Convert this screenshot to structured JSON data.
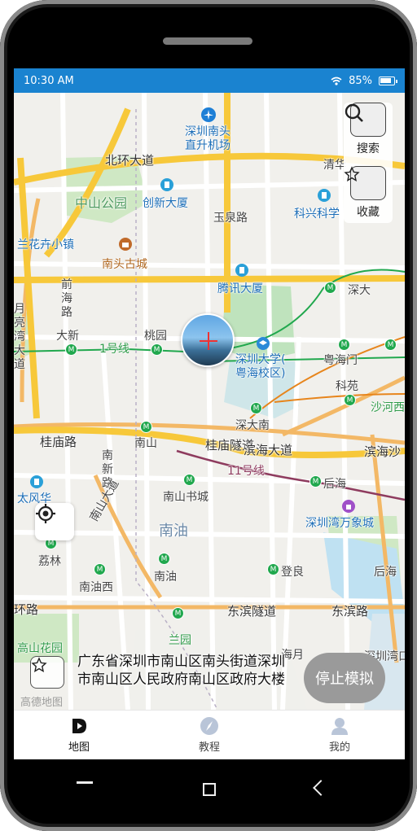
{
  "status_bar": {
    "time": "10:30 AM",
    "battery_percent": "85%",
    "battery_level": 0.85,
    "icons": [
      "wifi-icon",
      "battery-icon"
    ]
  },
  "map": {
    "labels": {
      "airport": "深圳南头\n直升机场",
      "beihuan": "北环大道",
      "qinghu": "清华",
      "zhongshan_park": "中山公园",
      "chuangxin": "创新大厦",
      "yuquan": "玉泉路",
      "kexing": "科兴科学",
      "nantou_old": "南头古城",
      "tencent": "腾讯大厦",
      "flower_town": "兰花卉小镇",
      "qianhai_rd": "前\n海\n路",
      "yueliangwan": "月\n亮\n湾\n大\n道",
      "daxin": "大新",
      "taoyuan": "桃园",
      "line1": "1号线",
      "shenzhen_univ": "深圳大学(\n粤海校区)",
      "shenda": "深大",
      "yuehaimen": "粤海门",
      "kexue": "科苑",
      "shahe": "沙河西",
      "shendanan": "深大南",
      "guimiao": "桂庙路",
      "nanshan_stn": "南山",
      "guimiao_tunnel": "桂庙隧道",
      "binhai": "滨海大道",
      "binhai2": "滨海沙",
      "line11": "11号线",
      "houhai": "后海",
      "nanxin": "南\n新\n路",
      "nanshan_ave": "南山大道",
      "nanshan_books": "南山书城",
      "nanyou": "南油",
      "mixc": "深圳湾万象城",
      "taifeng": "太风华",
      "lilin": "荔林",
      "nanyouxi": "南油西",
      "nanyou_stn": "南油",
      "dengliang": "登良",
      "houhai2": "后海",
      "dongbin_rd": "东滨路",
      "dongbin_tunnel": "东滨隧道",
      "dongbin2": "东滨路",
      "huan_rd": "环路",
      "lanyuan": "兰园",
      "gaoxin_park": "高山花园",
      "haiyue": "海月",
      "wanke": "深圳湾口岸",
      "gaode": "高德地图"
    }
  },
  "side_panel": {
    "search_label": "搜索",
    "favorite_label": "收藏"
  },
  "address": {
    "text": "广东省深圳市南山区南头街道深圳市南山区人民政府南山区政府大楼"
  },
  "stop_button": "停止模拟",
  "tabs": [
    {
      "label": "地图",
      "icon": "map-play-icon"
    },
    {
      "label": "教程",
      "icon": "compass-icon"
    },
    {
      "label": "我的",
      "icon": "user-icon"
    }
  ],
  "colors": {
    "status_bar": "#1a83d0",
    "metro_line1": "#21a84e",
    "road_major": "#f7c83a",
    "stop_button": "#9a9a9a"
  }
}
